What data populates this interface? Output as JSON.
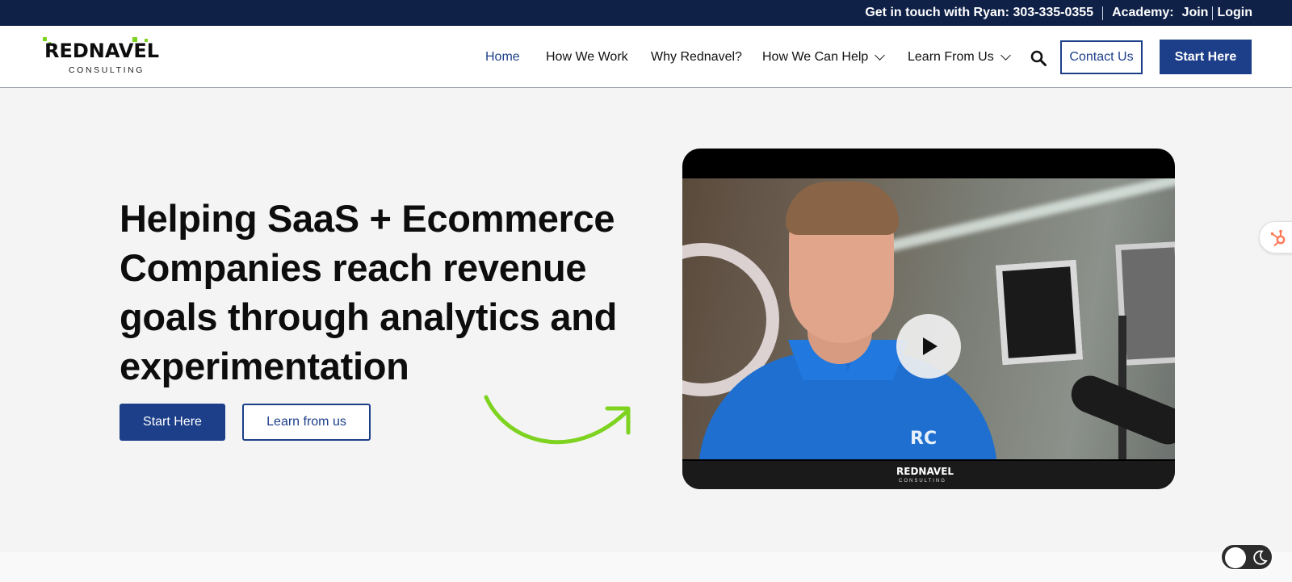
{
  "topbar": {
    "contact_text": "Get in touch with Ryan: 303-335-0355",
    "academy_label": "Academy:",
    "join_label": "Join",
    "login_label": "Login"
  },
  "header": {
    "logo_word": "REDNAVEL",
    "logo_sub": "CONSULTING",
    "nav": {
      "home": "Home",
      "how_we_work": "How We Work",
      "why": "Why Rednavel?",
      "how_we_can_help": "How We Can Help",
      "learn_from_us": "Learn From Us"
    },
    "contact_button": "Contact Us",
    "start_button": "Start Here"
  },
  "hero": {
    "title": "Helping SaaS + Ecommerce Companies reach revenue goals through analytics and experimentation",
    "primary_button": "Start Here",
    "secondary_button": "Learn from us"
  },
  "video": {
    "shirt_logo": "RC",
    "brand_word": "REDNAVEL",
    "brand_sub": "CONSULTING"
  },
  "colors": {
    "topbar": "#0f2147",
    "primary": "#1d3f8a",
    "accent_green": "#7ed321",
    "hubspot_orange": "#ff7a59"
  },
  "icons": {
    "search": "search-icon",
    "play": "play-icon",
    "hubspot": "hubspot-icon",
    "moon": "moon-icon",
    "arrow": "curved-arrow"
  }
}
